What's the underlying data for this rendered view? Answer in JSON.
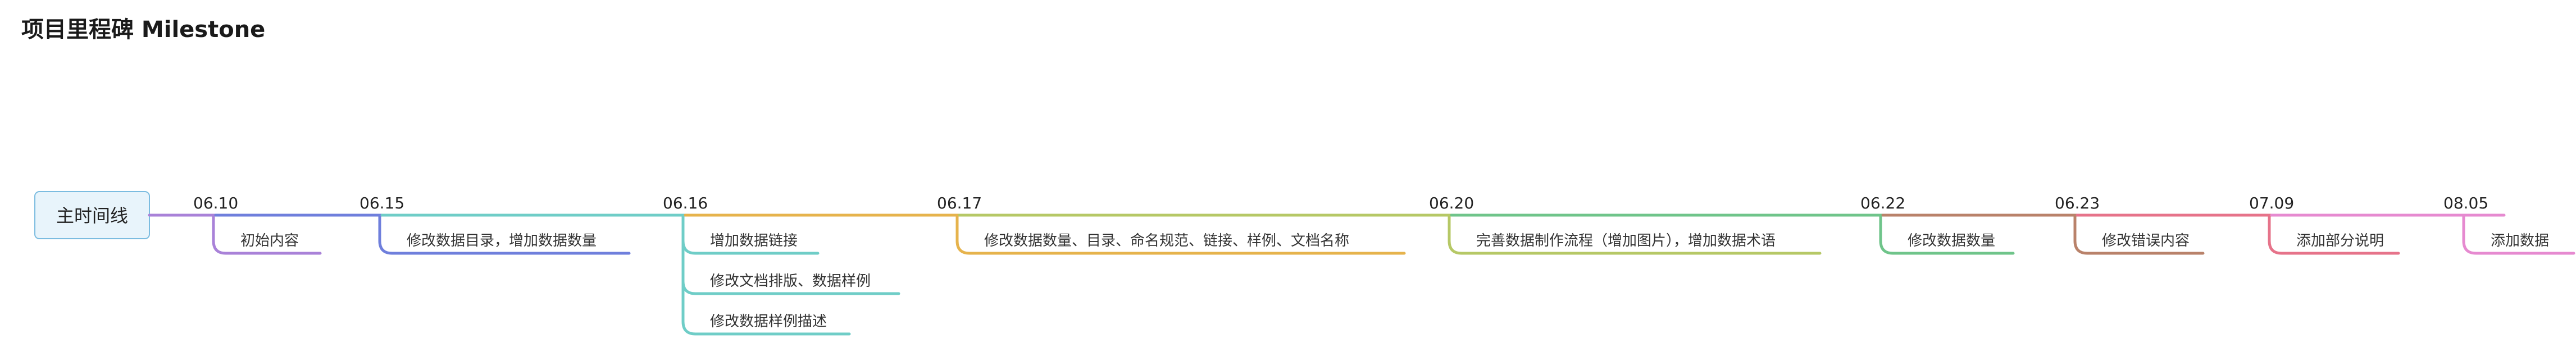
{
  "title": "项目里程碑 Milestone",
  "root": {
    "label": "主时间线",
    "fill": "#e8f4fb",
    "border": "#7bbce0"
  },
  "milestones": [
    {
      "date": "06.10",
      "color": "#a982d8",
      "items": [
        "初始内容"
      ]
    },
    {
      "date": "06.15",
      "color": "#6f7fdc",
      "items": [
        "修改数据目录，增加数据数量"
      ]
    },
    {
      "date": "06.16",
      "color": "#6fcdc7",
      "items": [
        "增加数据链接",
        "修改文档排版、数据样例",
        "修改数据样例描述"
      ]
    },
    {
      "date": "06.17",
      "color": "#e6b34c",
      "items": [
        "修改数据数量、目录、命名规范、链接、样例、文档名称"
      ]
    },
    {
      "date": "06.20",
      "color": "#b6c866",
      "items": [
        "完善数据制作流程（增加图片），增加数据术语"
      ]
    },
    {
      "date": "06.22",
      "color": "#6fc48a",
      "items": [
        "修改数据数量"
      ]
    },
    {
      "date": "06.23",
      "color": "#b9826a",
      "items": [
        "修改错误内容"
      ]
    },
    {
      "date": "07.09",
      "color": "#e6738a",
      "items": [
        "添加部分说明"
      ]
    },
    {
      "date": "08.05",
      "color": "#e68ad0",
      "items": [
        "添加数据"
      ]
    }
  ]
}
